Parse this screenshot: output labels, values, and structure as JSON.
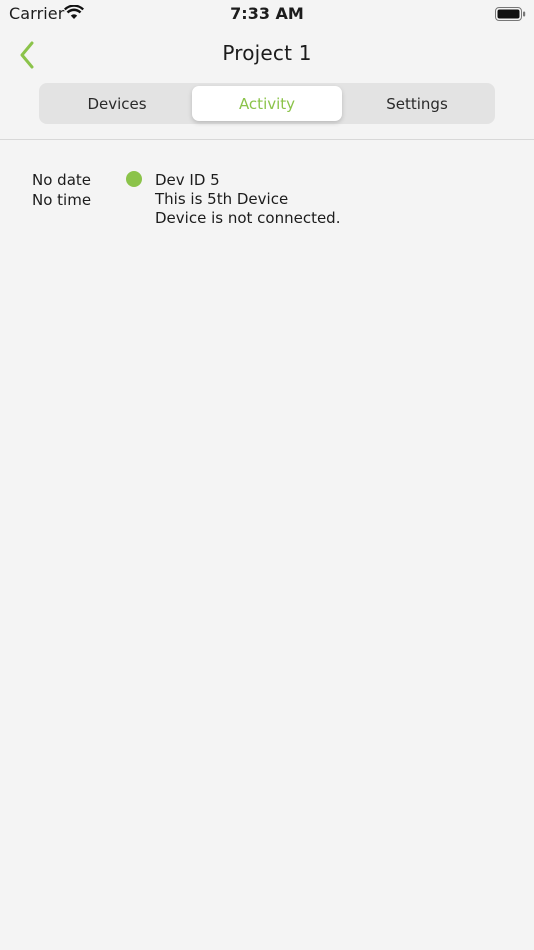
{
  "status_bar": {
    "carrier": "Carrier",
    "time": "7:33 AM"
  },
  "nav": {
    "title": "Project 1",
    "back_icon": "chevron-left-icon"
  },
  "tabs": [
    {
      "label": "Devices",
      "selected": false
    },
    {
      "label": "Activity",
      "selected": true
    },
    {
      "label": "Settings",
      "selected": false
    }
  ],
  "activity": [
    {
      "date": "No date",
      "time": "No time",
      "device_id": "Dev ID 5",
      "description": "This is 5th Device",
      "status_text": "Device is not connected.",
      "status_color": "#8bc34a"
    }
  ],
  "colors": {
    "accent": "#8bc34a",
    "background": "#f4f4f4"
  }
}
